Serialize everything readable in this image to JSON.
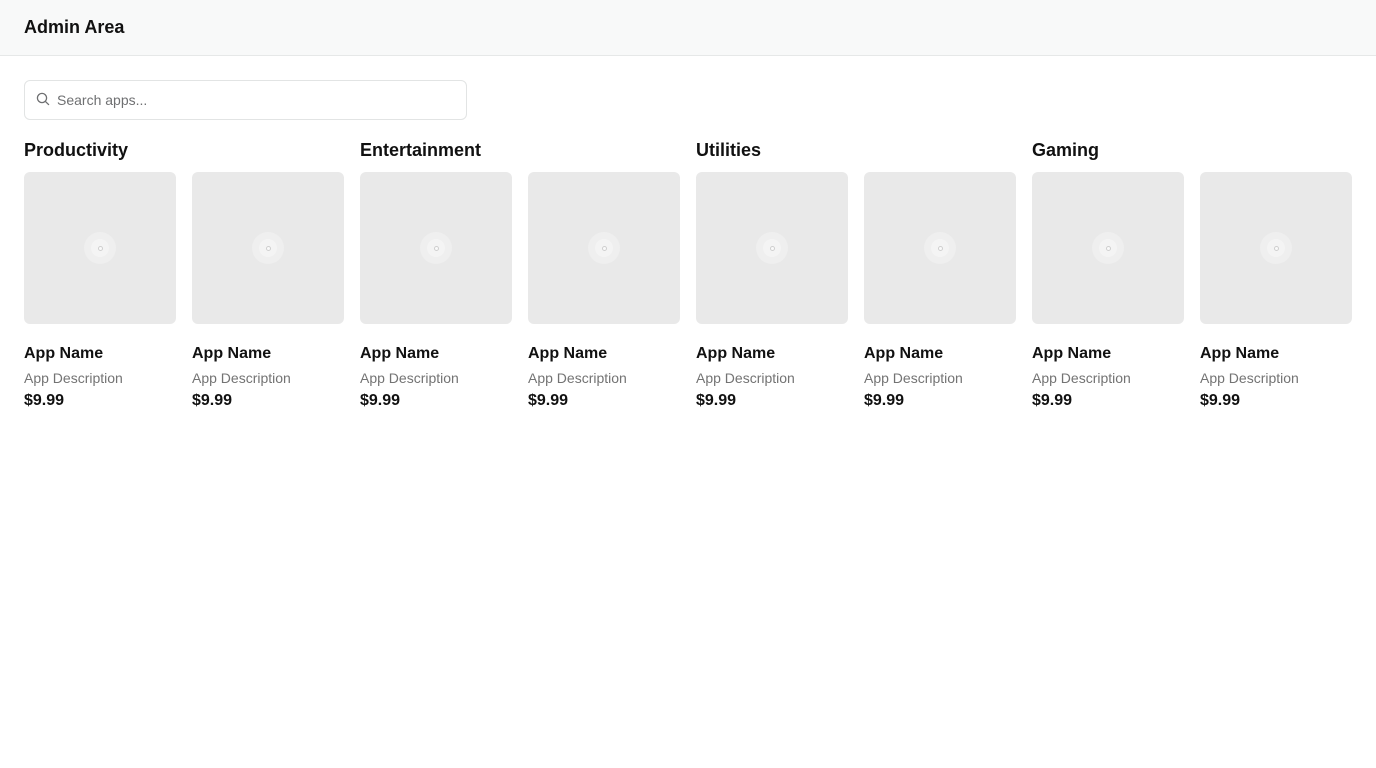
{
  "header": {
    "title": "Admin Area"
  },
  "search": {
    "placeholder": "Search apps...",
    "value": "",
    "icon": "search-icon"
  },
  "categories": [
    {
      "title": "Productivity",
      "apps": [
        {
          "name": "App Name",
          "description": "App Description",
          "price": "$9.99"
        },
        {
          "name": "App Name",
          "description": "App Description",
          "price": "$9.99"
        }
      ]
    },
    {
      "title": "Entertainment",
      "apps": [
        {
          "name": "App Name",
          "description": "App Description",
          "price": "$9.99"
        },
        {
          "name": "App Name",
          "description": "App Description",
          "price": "$9.99"
        }
      ]
    },
    {
      "title": "Utilities",
      "apps": [
        {
          "name": "App Name",
          "description": "App Description",
          "price": "$9.99"
        },
        {
          "name": "App Name",
          "description": "App Description",
          "price": "$9.99"
        }
      ]
    },
    {
      "title": "Gaming",
      "apps": [
        {
          "name": "App Name",
          "description": "App Description",
          "price": "$9.99"
        },
        {
          "name": "App Name",
          "description": "App Description",
          "price": "$9.99"
        }
      ]
    }
  ],
  "colors": {
    "header_bg": "#f8f9f9",
    "thumb_bg": "#e9e9e9",
    "text": "#111111",
    "muted_text": "#737373"
  }
}
